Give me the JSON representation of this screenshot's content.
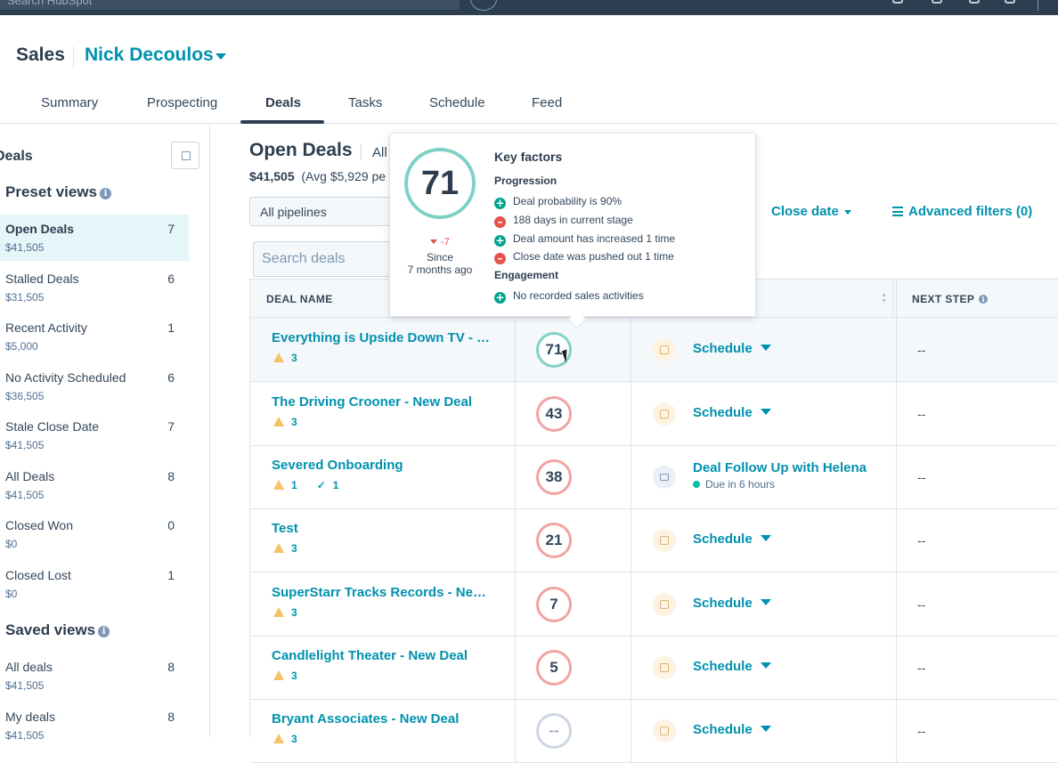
{
  "topbar": {
    "search_placeholder": "Search HubSpot"
  },
  "header": {
    "title": "Sales",
    "user": "Nick Decoulos"
  },
  "tabs": [
    "Summary",
    "Prospecting",
    "Deals",
    "Tasks",
    "Schedule",
    "Feed"
  ],
  "active_tab": "Deals",
  "sidebar": {
    "title": "Deals",
    "preset_title": "Preset views",
    "preset_items": [
      {
        "label": "Open Deals",
        "amount": "$41,505",
        "count": "7",
        "active": true
      },
      {
        "label": "Stalled Deals",
        "amount": "$31,505",
        "count": "6"
      },
      {
        "label": "Recent Activity",
        "amount": "$5,000",
        "count": "1"
      },
      {
        "label": "No Activity Scheduled",
        "amount": "$36,505",
        "count": "6"
      },
      {
        "label": "Stale Close Date",
        "amount": "$41,505",
        "count": "7"
      },
      {
        "label": "All Deals",
        "amount": "$41,505",
        "count": "8"
      },
      {
        "label": "Closed Won",
        "amount": "$0",
        "count": "0"
      },
      {
        "label": "Closed Lost",
        "amount": "$0",
        "count": "1"
      }
    ],
    "saved_title": "Saved views",
    "saved_items": [
      {
        "label": "All deals",
        "amount": "$41,505",
        "count": "8"
      },
      {
        "label": "My deals",
        "amount": "$41,505",
        "count": "8"
      }
    ]
  },
  "main": {
    "title": "Open Deals",
    "all_label": "All",
    "total": "$41,505",
    "avg": "(Avg $5,929 pe",
    "pipeline": "All pipelines",
    "close_date": "Close date",
    "advanced_filters": "Advanced filters (0)",
    "search_placeholder": "Search deals"
  },
  "table": {
    "headers": {
      "deal_name": "DEAL NAME",
      "next_step": "NEXT STEP"
    },
    "rows": [
      {
        "name": "Everything is Upside Down TV - N...",
        "warnings": "3",
        "score": "71",
        "score_type": "good",
        "activity": "Schedule",
        "next": "--"
      },
      {
        "name": "The Driving Crooner - New Deal",
        "warnings": "3",
        "score": "43",
        "score_type": "bad",
        "activity": "Schedule",
        "next": "--"
      },
      {
        "name": "Severed Onboarding",
        "warnings": "1",
        "checks": "1",
        "score": "38",
        "score_type": "bad",
        "activity": "Deal Follow Up with Helena",
        "due": "Due in 6 hours",
        "next": "--"
      },
      {
        "name": "Test",
        "warnings": "3",
        "score": "21",
        "score_type": "bad",
        "activity": "Schedule",
        "next": "--"
      },
      {
        "name": "SuperStarr Tracks Records - New ...",
        "warnings": "3",
        "score": "7",
        "score_type": "bad",
        "activity": "Schedule",
        "next": "--"
      },
      {
        "name": "Candlelight Theater - New Deal",
        "warnings": "3",
        "score": "5",
        "score_type": "bad",
        "activity": "Schedule",
        "next": "--"
      },
      {
        "name": "Bryant Associates - New Deal",
        "warnings": "3",
        "score": "--",
        "score_type": "none",
        "activity": "Schedule",
        "next": "--"
      }
    ]
  },
  "popover": {
    "score": "71",
    "delta": "-7",
    "since_label": "Since",
    "since_value": "7 months ago",
    "title": "Key factors",
    "progression_title": "Progression",
    "progression": [
      {
        "type": "plus",
        "text": "Deal probability is 90%"
      },
      {
        "type": "minus",
        "text": "188 days in current stage"
      },
      {
        "type": "plus",
        "text": "Deal amount has increased 1 time"
      },
      {
        "type": "minus",
        "text": "Close date was pushed out 1 time"
      }
    ],
    "engagement_title": "Engagement",
    "engagement": [
      {
        "type": "plus",
        "text": "No recorded sales activities"
      }
    ]
  }
}
